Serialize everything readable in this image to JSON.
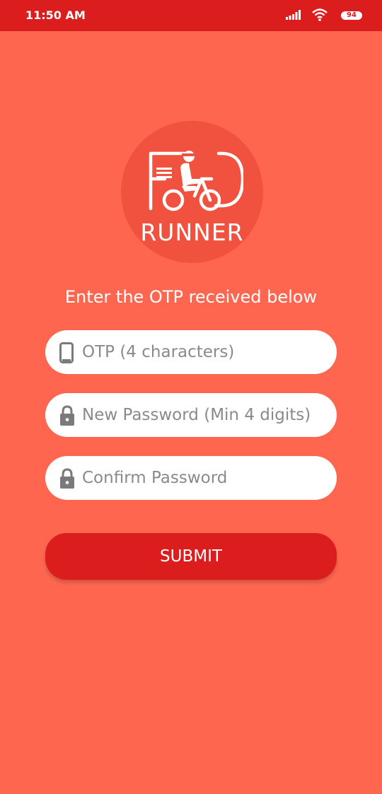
{
  "status_bar": {
    "time": "11:50 AM",
    "battery": "94"
  },
  "logo": {
    "word": "RUNNER"
  },
  "form": {
    "prompt": "Enter the OTP received below",
    "otp_placeholder": "OTP (4 characters)",
    "new_password_placeholder": "New Password (Min 4 digits)",
    "confirm_password_placeholder": "Confirm Password",
    "submit_label": "SUBMIT"
  },
  "colors": {
    "background": "#ff6650",
    "status_bar": "#db1d1d",
    "logo_circle": "#f0523f",
    "submit_button": "#db1d1d"
  },
  "icons": {
    "otp_field": "phone-icon",
    "password_fields": "lock-icon"
  }
}
